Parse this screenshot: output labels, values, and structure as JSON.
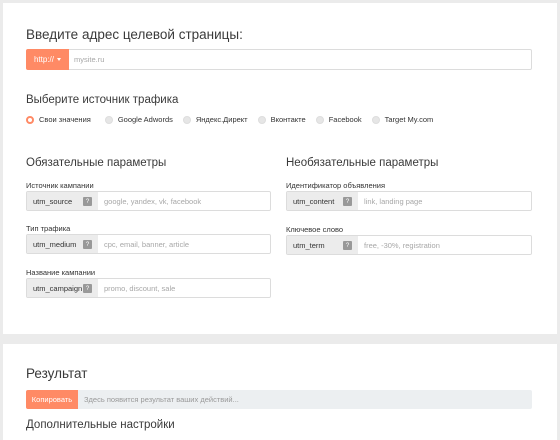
{
  "url_section": {
    "title": "Введите адрес целевой страницы:",
    "protocol_label": "http://",
    "url_placeholder": "mysite.ru",
    "url_value": ""
  },
  "source_section": {
    "title": "Выберите источник трафика",
    "options": [
      {
        "label": "Свои значения",
        "selected": true
      },
      {
        "label": "Google Adwords",
        "selected": false
      },
      {
        "label": "Яндекс.Директ",
        "selected": false
      },
      {
        "label": "Вконтакте",
        "selected": false
      },
      {
        "label": "Facebook",
        "selected": false
      },
      {
        "label": "Target My.com",
        "selected": false
      }
    ]
  },
  "required_params": {
    "title": "Обязательные параметры",
    "fields": [
      {
        "label": "Источник кампании",
        "tag": "utm_source",
        "placeholder": "google, yandex, vk, facebook"
      },
      {
        "label": "Тип трафика",
        "tag": "utm_medium",
        "placeholder": "cpc, email, banner, article"
      },
      {
        "label": "Название кампании",
        "tag": "utm_campaign",
        "placeholder": "promo, discount, sale"
      }
    ]
  },
  "optional_params": {
    "title": "Необязательные параметры",
    "fields": [
      {
        "label": "Идентификатор объявления",
        "tag": "utm_content",
        "placeholder": "link, landing page"
      },
      {
        "label": "Ключевое слово",
        "tag": "utm_term",
        "placeholder": "free, -30%, registration"
      }
    ]
  },
  "help_glyph": "?",
  "result_section": {
    "title": "Результат",
    "copy_label": "Копировать",
    "result_placeholder": "Здесь появится результат ваших действий...",
    "extra_title": "Дополнительные настройки"
  },
  "colors": {
    "accent": "#ff8a65",
    "background": "#ebebeb",
    "tag_bg": "#ececec",
    "result_bg": "#eceff1"
  }
}
